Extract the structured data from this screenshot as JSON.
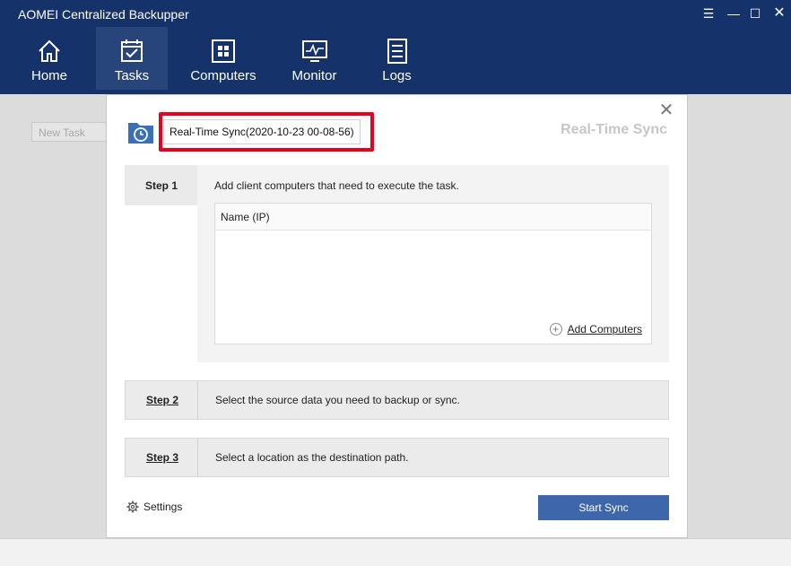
{
  "app": {
    "title": "AOMEI Centralized Backupper"
  },
  "window_controls": {
    "menu": "☰",
    "minimize": "—",
    "maximize": "☐",
    "close": "✕"
  },
  "nav": {
    "home": "Home",
    "tasks": "Tasks",
    "computers": "Computers",
    "monitor": "Monitor",
    "logs": "Logs",
    "active": "Tasks"
  },
  "background": {
    "new_task": "New Task"
  },
  "dialog": {
    "task_name": "Real-Time Sync(2020-10-23 00-08-56)",
    "type_label": "Real-Time Sync",
    "close": "✕",
    "step1": {
      "label": "Step 1",
      "description": "Add client computers that need to execute the task.",
      "column_header": "Name (IP)",
      "add_computers": "Add Computers"
    },
    "step2": {
      "label": "Step 2",
      "description": "Select the source data you need to backup or sync."
    },
    "step3": {
      "label": "Step 3",
      "description": "Select a location as the destination path."
    },
    "settings": "Settings",
    "start_button": "Start Sync"
  },
  "colors": {
    "topbar": "#15336a",
    "highlight": "#e8001c",
    "primary_button": "#3e66aa"
  }
}
